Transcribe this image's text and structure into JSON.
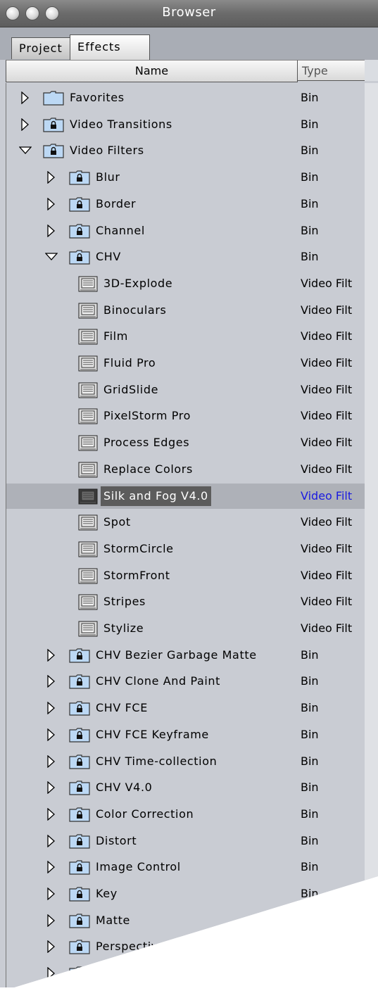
{
  "window": {
    "title": "Browser"
  },
  "tabs": [
    {
      "label": "Project",
      "active": false
    },
    {
      "label": "Effects",
      "active": true
    }
  ],
  "columns": {
    "name": "Name",
    "type": "Type"
  },
  "rows": [
    {
      "name": "Favorites",
      "type": "Bin",
      "level": 0,
      "icon": "folder-icon",
      "disclosure": "collapsed"
    },
    {
      "name": "Video Transitions",
      "type": "Bin",
      "level": 0,
      "icon": "locked-bin-icon",
      "disclosure": "collapsed"
    },
    {
      "name": "Video Filters",
      "type": "Bin",
      "level": 0,
      "icon": "locked-bin-icon",
      "disclosure": "expanded"
    },
    {
      "name": "Blur",
      "type": "Bin",
      "level": 1,
      "icon": "locked-bin-icon",
      "disclosure": "collapsed"
    },
    {
      "name": "Border",
      "type": "Bin",
      "level": 1,
      "icon": "locked-bin-icon",
      "disclosure": "collapsed"
    },
    {
      "name": "Channel",
      "type": "Bin",
      "level": 1,
      "icon": "locked-bin-icon",
      "disclosure": "collapsed"
    },
    {
      "name": "CHV",
      "type": "Bin",
      "level": 1,
      "icon": "locked-bin-icon",
      "disclosure": "expanded"
    },
    {
      "name": "3D-Explode",
      "type": "Video Filt",
      "level": 2,
      "icon": "video-filter-icon"
    },
    {
      "name": "Binoculars",
      "type": "Video Filt",
      "level": 2,
      "icon": "video-filter-icon"
    },
    {
      "name": "Film",
      "type": "Video Filt",
      "level": 2,
      "icon": "video-filter-icon"
    },
    {
      "name": "Fluid Pro",
      "type": "Video Filt",
      "level": 2,
      "icon": "video-filter-icon"
    },
    {
      "name": "GridSlide",
      "type": "Video Filt",
      "level": 2,
      "icon": "video-filter-icon"
    },
    {
      "name": "PixelStorm Pro",
      "type": "Video Filt",
      "level": 2,
      "icon": "video-filter-icon"
    },
    {
      "name": "Process Edges",
      "type": "Video Filt",
      "level": 2,
      "icon": "video-filter-icon"
    },
    {
      "name": "Replace Colors",
      "type": "Video Filt",
      "level": 2,
      "icon": "video-filter-icon"
    },
    {
      "name": "Silk and Fog V4.0",
      "type": "Video Filt",
      "level": 2,
      "icon": "video-filter-icon",
      "selected": true
    },
    {
      "name": "Spot",
      "type": "Video Filt",
      "level": 2,
      "icon": "video-filter-icon"
    },
    {
      "name": "StormCircle",
      "type": "Video Filt",
      "level": 2,
      "icon": "video-filter-icon"
    },
    {
      "name": "StormFront",
      "type": "Video Filt",
      "level": 2,
      "icon": "video-filter-icon"
    },
    {
      "name": "Stripes",
      "type": "Video Filt",
      "level": 2,
      "icon": "video-filter-icon"
    },
    {
      "name": "Stylize",
      "type": "Video Filt",
      "level": 2,
      "icon": "video-filter-icon"
    },
    {
      "name": "CHV Bezier Garbage Matte",
      "type": "Bin",
      "level": 1,
      "icon": "locked-bin-icon",
      "disclosure": "collapsed"
    },
    {
      "name": "CHV Clone And Paint",
      "type": "Bin",
      "level": 1,
      "icon": "locked-bin-icon",
      "disclosure": "collapsed"
    },
    {
      "name": "CHV FCE",
      "type": "Bin",
      "level": 1,
      "icon": "locked-bin-icon",
      "disclosure": "collapsed"
    },
    {
      "name": "CHV FCE Keyframe",
      "type": "Bin",
      "level": 1,
      "icon": "locked-bin-icon",
      "disclosure": "collapsed"
    },
    {
      "name": "CHV Time-collection",
      "type": "Bin",
      "level": 1,
      "icon": "locked-bin-icon",
      "disclosure": "collapsed"
    },
    {
      "name": "CHV V4.0",
      "type": "Bin",
      "level": 1,
      "icon": "locked-bin-icon",
      "disclosure": "collapsed"
    },
    {
      "name": "Color Correction",
      "type": "Bin",
      "level": 1,
      "icon": "locked-bin-icon",
      "disclosure": "collapsed"
    },
    {
      "name": "Distort",
      "type": "Bin",
      "level": 1,
      "icon": "locked-bin-icon",
      "disclosure": "collapsed"
    },
    {
      "name": "Image Control",
      "type": "Bin",
      "level": 1,
      "icon": "locked-bin-icon",
      "disclosure": "collapsed"
    },
    {
      "name": "Key",
      "type": "Bin",
      "level": 1,
      "icon": "locked-bin-icon",
      "disclosure": "collapsed"
    },
    {
      "name": "Matte",
      "type": "Bin",
      "level": 1,
      "icon": "locked-bin-icon",
      "disclosure": "collapsed"
    },
    {
      "name": "Perspective",
      "type": "Bin",
      "level": 1,
      "icon": "locked-bin-icon",
      "disclosure": "collapsed"
    },
    {
      "name": "",
      "type": "",
      "level": 1,
      "icon": "locked-bin-icon",
      "disclosure": "collapsed"
    }
  ],
  "colors": {
    "selection_label_bg": "#5c5c5c",
    "selection_type_text": "#1a1ae0",
    "list_bg": "#c9ccd3",
    "bin_icon_fill": "#bcd8f4"
  }
}
